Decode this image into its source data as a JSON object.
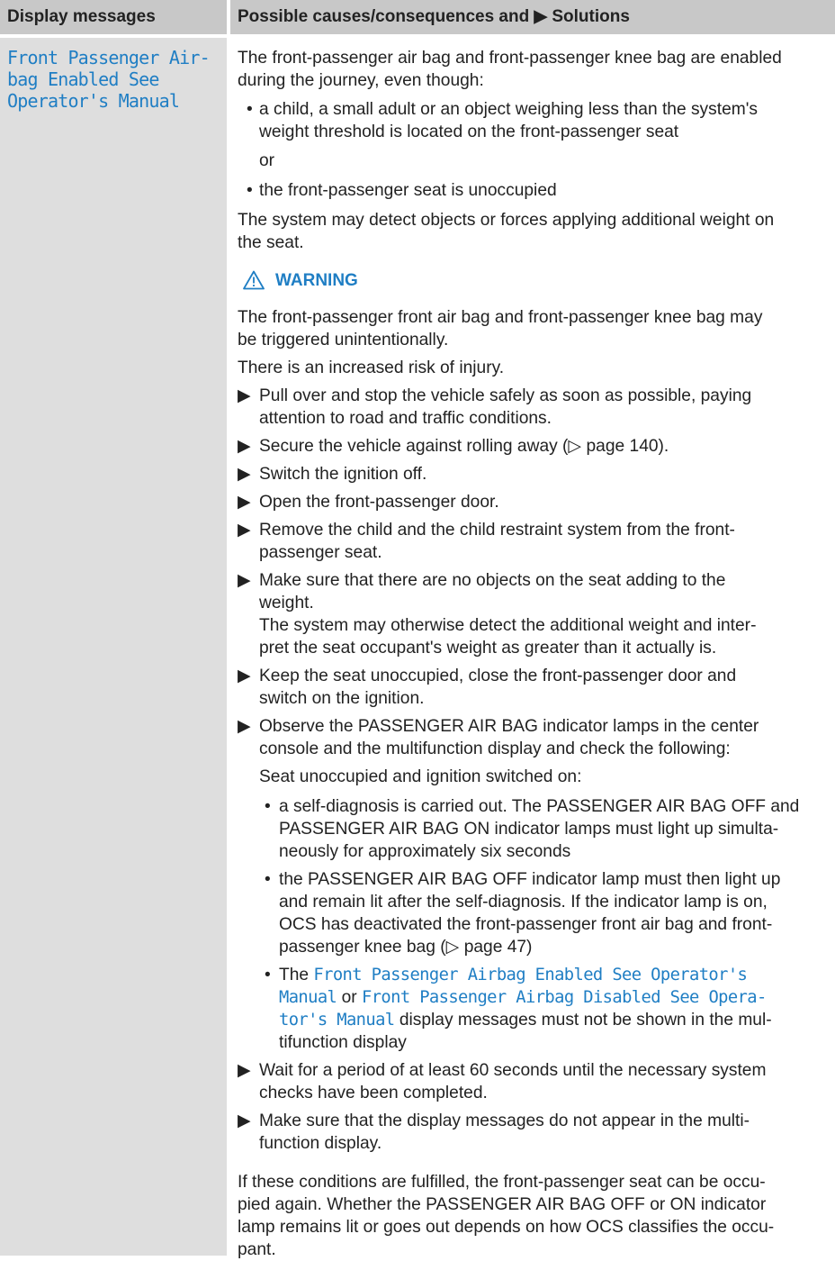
{
  "header": {
    "left": "Display messages",
    "right": "Possible causes/consequences and ▶ Solutions"
  },
  "message": {
    "line1": "Front Passenger Air-",
    "line2": "bag Enabled See",
    "line3": "Operator's Manual"
  },
  "content": {
    "intro1": "The front-passenger air bag and front-passenger knee bag are enabled",
    "intro2": "during the journey, even though:",
    "b1l1": "a child, a small adult or an object weighing less than the system's",
    "b1l2": "weight threshold is located on the front-passenger seat",
    "or": "or",
    "b2": "the front-passenger seat is unoccupied",
    "p2l1": "The system may detect objects or forces applying additional weight on",
    "p2l2": "the seat.",
    "warning": "WARNING",
    "w1l1": "The front-passenger front air bag and front-passenger knee bag may",
    "w1l2": "be triggered unintentionally.",
    "w2": "There is an increased risk of injury.",
    "s1l1": "Pull over and stop the vehicle safely as soon as possible, paying",
    "s1l2": "attention to road and traffic conditions.",
    "s2": "Secure the vehicle against rolling away (▷ page 140).",
    "s3": "Switch the ignition off.",
    "s4": "Open the front-passenger door.",
    "s5l1": "Remove the child and the child restraint system from the front-",
    "s5l2": "passenger seat.",
    "s6l1": "Make sure that there are no objects on the seat adding to the",
    "s6l2": "weight.",
    "s6l3": "The system may otherwise detect the additional weight and inter-",
    "s6l4": "pret the seat occupant's weight as greater than it actually is.",
    "s7l1": "Keep the seat unoccupied, close the front-passenger door and",
    "s7l2": "switch on the ignition.",
    "s8l1": "Observe the PASSENGER AIR BAG indicator lamps in the center",
    "s8l2": "console and the multifunction display and check the following:",
    "s8l3": "Seat unoccupied and ignition switched on:",
    "sb1l1": "a self-diagnosis is carried out. The PASSENGER AIR BAG OFF and",
    "sb1l2": "PASSENGER AIR BAG ON indicator lamps must light up simulta-",
    "sb1l3": "neously for approximately six seconds",
    "sb2l1": "the PASSENGER AIR BAG OFF indicator lamp must then light up",
    "sb2l2": "and remain lit after the self-diagnosis. If the indicator lamp is on,",
    "sb2l3": "OCS has deactivated the front-passenger front air bag and front-",
    "sb2l4": "passenger knee bag (▷ page 47)",
    "sb3_the": "The ",
    "sb3_m1a": "Front Passenger Airbag Enabled See Operator's",
    "sb3_m1b": "Manual",
    "sb3_or": " or ",
    "sb3_m2a": "Front Passenger Airbag Disabled See Opera-",
    "sb3_m2b": "tor's Manual",
    "sb3_tail1": " display messages must not be shown in the mul-",
    "sb3_tail2": "tifunction display",
    "s9l1": "Wait for a period of at least 60 seconds until the necessary system",
    "s9l2": "checks have been completed.",
    "s10l1": "Make sure that the display messages do not appear in the multi-",
    "s10l2": "function display.",
    "f1": "If these conditions are fulfilled, the front-passenger seat can be occu-",
    "f2": "pied again. Whether the PASSENGER AIR BAG OFF or ON indicator",
    "f3": "lamp remains lit or goes out depends on how OCS classifies the occu-",
    "f4": "pant."
  },
  "colors": {
    "accent": "#1f7ec4",
    "header_bg": "#c8c8c8",
    "left_col_bg": "#dedede"
  },
  "icons": {
    "warning": "warning-triangle-icon",
    "step": "arrow-right-icon",
    "bullet": "bullet-icon"
  }
}
